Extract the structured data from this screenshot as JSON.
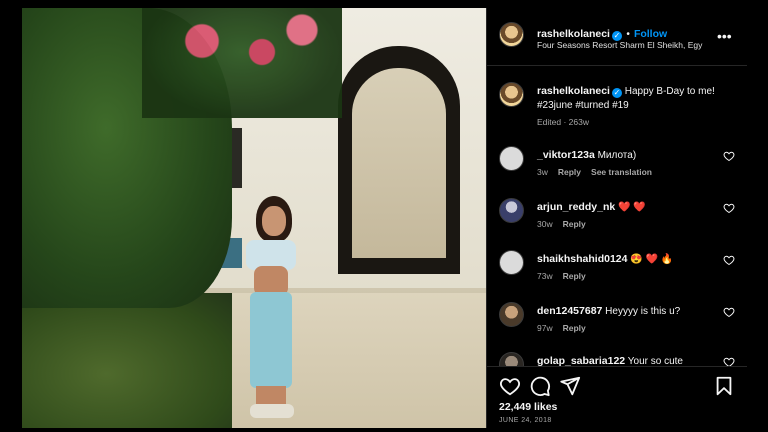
{
  "post": {
    "username": "rashelkolaneci",
    "follow_label": "Follow",
    "location": "Four Seasons Resort Sharm El Sheikh, Egy",
    "caption": "Happy B-Day to me! #23june #turned #19",
    "caption_meta": "Edited · 263w",
    "likes": "22,449 likes",
    "date": "JUNE 24, 2018"
  },
  "comments": [
    {
      "username": "_viktor123a",
      "text": "Милота)",
      "time": "3w",
      "reply": "Reply",
      "translate": "See translation"
    },
    {
      "username": "arjun_reddy_nk",
      "text": "❤️ ❤️",
      "time": "30w",
      "reply": "Reply"
    },
    {
      "username": "shaikhshahid0124",
      "text": "😍 ❤️ 🔥",
      "time": "73w",
      "reply": "Reply"
    },
    {
      "username": "den12457687",
      "text": "Heyyyy is this u?",
      "time": "97w",
      "reply": "Reply"
    },
    {
      "username": "golap_sabaria122",
      "text": "Your so cute",
      "time": "",
      "reply": ""
    }
  ],
  "icons": [
    "verified-badge-icon",
    "more-options-icon",
    "heart-icon",
    "comment-icon",
    "share-icon",
    "bookmark-icon"
  ],
  "colors": {
    "accent": "#0095f6",
    "background": "#000000",
    "text": "#f5f5f5",
    "muted": "#a8a8a8",
    "heart_red": "#ed4956"
  }
}
